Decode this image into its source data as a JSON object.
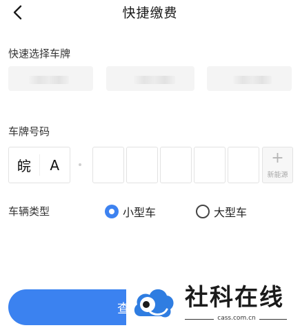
{
  "header": {
    "title": "快捷缴费",
    "back_icon": "chevron-left-icon"
  },
  "quick_select": {
    "label": "快速选择车牌",
    "plates": [
      "",
      "",
      ""
    ]
  },
  "plate_number": {
    "label": "车牌号码",
    "province": "皖",
    "city_letter": "A",
    "digits": [
      "",
      "",
      "",
      "",
      ""
    ],
    "new_energy_label": "新能源"
  },
  "vehicle_type": {
    "label": "车辆类型",
    "options": [
      {
        "label": "小型车",
        "selected": true
      },
      {
        "label": "大型车",
        "selected": false
      }
    ]
  },
  "query_button": {
    "label": "查"
  },
  "watermark": {
    "brand": "社科在线",
    "url": "cass.com.cn"
  },
  "colors": {
    "accent": "#3b82f0",
    "watermark_blue": "#2f7de1"
  }
}
